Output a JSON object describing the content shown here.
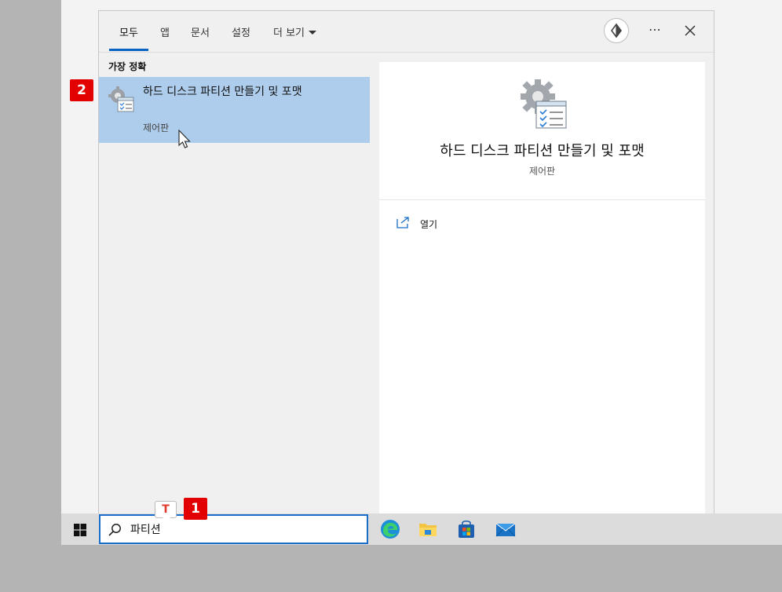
{
  "tabs": [
    {
      "label": "모두"
    },
    {
      "label": "앱"
    },
    {
      "label": "문서"
    },
    {
      "label": "설정"
    },
    {
      "label": "더 보기"
    }
  ],
  "header": {
    "avatar_icon": "user-avatar-icon",
    "more_icon": "more-icon",
    "more_glyph": "⋯",
    "close_icon": "close-icon"
  },
  "best_match": {
    "section_title": "가장 정확",
    "title": "하드 디스크 파티션 만들기 및 포맷",
    "subtitle": "제어판"
  },
  "preview": {
    "title": "하드 디스크 파티션 만들기 및 포맷",
    "subtitle": "제어판",
    "actions": [
      {
        "label": "열기",
        "icon": "open-icon"
      }
    ]
  },
  "badges": [
    "1",
    "2"
  ],
  "search": {
    "value": "파티션"
  },
  "t_bubble": "T",
  "colors": {
    "accent": "#0a64c4",
    "selection": "#aecdec",
    "badge": "#e20000"
  }
}
